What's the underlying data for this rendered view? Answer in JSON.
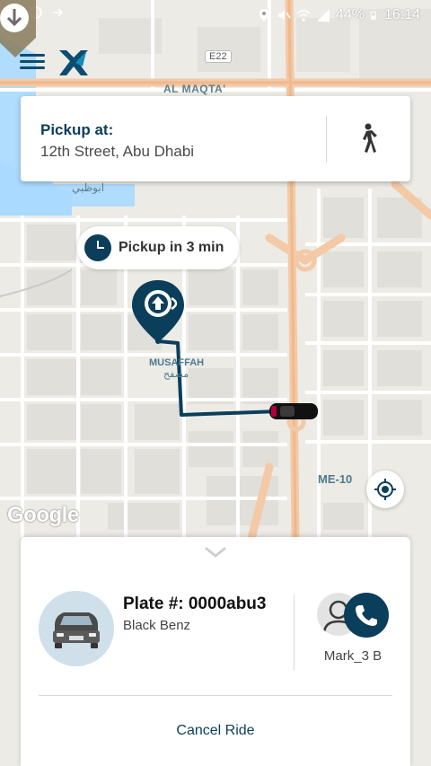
{
  "status_bar": {
    "battery": "44%",
    "time": "16:14",
    "icons": [
      "location-icon",
      "mute-icon",
      "wifi-icon",
      "signal-icon",
      "battery-icon"
    ]
  },
  "map": {
    "labels": {
      "district_north": "AL MAQTA'",
      "road_e22": "E22",
      "arabic_abudhabi": "ابوظبي",
      "district_musaffah": "MUSAFFAH",
      "district_musaffah_ar": "مصفح",
      "road_me10": "ME-10"
    },
    "attribution": "Google"
  },
  "pickup": {
    "title": "Pickup at:",
    "address": "12th Street, Abu Dhabi"
  },
  "eta": {
    "label": "Pickup in 3 min"
  },
  "ride": {
    "plate": "Plate #: 0000abu3",
    "car_model": "Black Benz",
    "driver_name": "Mark_3 B",
    "cancel_label": "Cancel Ride"
  },
  "colors": {
    "brand": "#0b3e5a",
    "accent": "#1a5f85",
    "route": "#0b3e5a",
    "major_road": "#f4c9a6"
  }
}
